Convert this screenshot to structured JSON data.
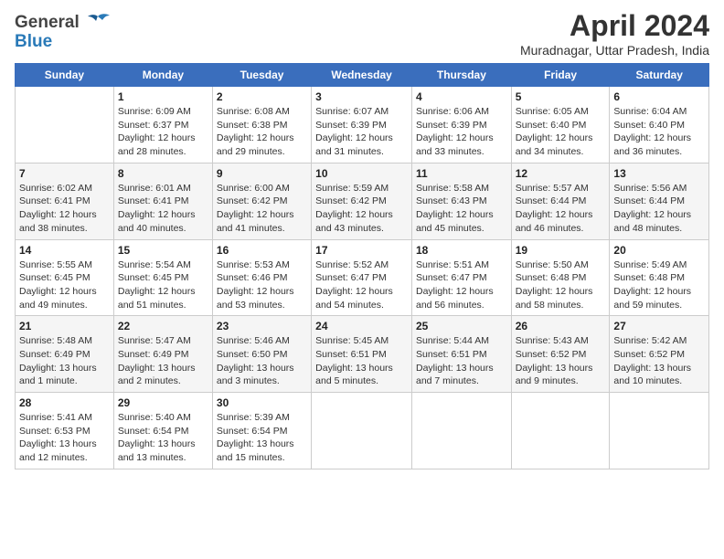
{
  "header": {
    "logo_line1": "General",
    "logo_line2": "Blue",
    "title": "April 2024",
    "subtitle": "Muradnagar, Uttar Pradesh, India"
  },
  "weekdays": [
    "Sunday",
    "Monday",
    "Tuesday",
    "Wednesday",
    "Thursday",
    "Friday",
    "Saturday"
  ],
  "weeks": [
    [
      {
        "day": "",
        "sunrise": "",
        "sunset": "",
        "daylight": ""
      },
      {
        "day": "1",
        "sunrise": "Sunrise: 6:09 AM",
        "sunset": "Sunset: 6:37 PM",
        "daylight": "Daylight: 12 hours and 28 minutes."
      },
      {
        "day": "2",
        "sunrise": "Sunrise: 6:08 AM",
        "sunset": "Sunset: 6:38 PM",
        "daylight": "Daylight: 12 hours and 29 minutes."
      },
      {
        "day": "3",
        "sunrise": "Sunrise: 6:07 AM",
        "sunset": "Sunset: 6:39 PM",
        "daylight": "Daylight: 12 hours and 31 minutes."
      },
      {
        "day": "4",
        "sunrise": "Sunrise: 6:06 AM",
        "sunset": "Sunset: 6:39 PM",
        "daylight": "Daylight: 12 hours and 33 minutes."
      },
      {
        "day": "5",
        "sunrise": "Sunrise: 6:05 AM",
        "sunset": "Sunset: 6:40 PM",
        "daylight": "Daylight: 12 hours and 34 minutes."
      },
      {
        "day": "6",
        "sunrise": "Sunrise: 6:04 AM",
        "sunset": "Sunset: 6:40 PM",
        "daylight": "Daylight: 12 hours and 36 minutes."
      }
    ],
    [
      {
        "day": "7",
        "sunrise": "Sunrise: 6:02 AM",
        "sunset": "Sunset: 6:41 PM",
        "daylight": "Daylight: 12 hours and 38 minutes."
      },
      {
        "day": "8",
        "sunrise": "Sunrise: 6:01 AM",
        "sunset": "Sunset: 6:41 PM",
        "daylight": "Daylight: 12 hours and 40 minutes."
      },
      {
        "day": "9",
        "sunrise": "Sunrise: 6:00 AM",
        "sunset": "Sunset: 6:42 PM",
        "daylight": "Daylight: 12 hours and 41 minutes."
      },
      {
        "day": "10",
        "sunrise": "Sunrise: 5:59 AM",
        "sunset": "Sunset: 6:42 PM",
        "daylight": "Daylight: 12 hours and 43 minutes."
      },
      {
        "day": "11",
        "sunrise": "Sunrise: 5:58 AM",
        "sunset": "Sunset: 6:43 PM",
        "daylight": "Daylight: 12 hours and 45 minutes."
      },
      {
        "day": "12",
        "sunrise": "Sunrise: 5:57 AM",
        "sunset": "Sunset: 6:44 PM",
        "daylight": "Daylight: 12 hours and 46 minutes."
      },
      {
        "day": "13",
        "sunrise": "Sunrise: 5:56 AM",
        "sunset": "Sunset: 6:44 PM",
        "daylight": "Daylight: 12 hours and 48 minutes."
      }
    ],
    [
      {
        "day": "14",
        "sunrise": "Sunrise: 5:55 AM",
        "sunset": "Sunset: 6:45 PM",
        "daylight": "Daylight: 12 hours and 49 minutes."
      },
      {
        "day": "15",
        "sunrise": "Sunrise: 5:54 AM",
        "sunset": "Sunset: 6:45 PM",
        "daylight": "Daylight: 12 hours and 51 minutes."
      },
      {
        "day": "16",
        "sunrise": "Sunrise: 5:53 AM",
        "sunset": "Sunset: 6:46 PM",
        "daylight": "Daylight: 12 hours and 53 minutes."
      },
      {
        "day": "17",
        "sunrise": "Sunrise: 5:52 AM",
        "sunset": "Sunset: 6:47 PM",
        "daylight": "Daylight: 12 hours and 54 minutes."
      },
      {
        "day": "18",
        "sunrise": "Sunrise: 5:51 AM",
        "sunset": "Sunset: 6:47 PM",
        "daylight": "Daylight: 12 hours and 56 minutes."
      },
      {
        "day": "19",
        "sunrise": "Sunrise: 5:50 AM",
        "sunset": "Sunset: 6:48 PM",
        "daylight": "Daylight: 12 hours and 58 minutes."
      },
      {
        "day": "20",
        "sunrise": "Sunrise: 5:49 AM",
        "sunset": "Sunset: 6:48 PM",
        "daylight": "Daylight: 12 hours and 59 minutes."
      }
    ],
    [
      {
        "day": "21",
        "sunrise": "Sunrise: 5:48 AM",
        "sunset": "Sunset: 6:49 PM",
        "daylight": "Daylight: 13 hours and 1 minute."
      },
      {
        "day": "22",
        "sunrise": "Sunrise: 5:47 AM",
        "sunset": "Sunset: 6:49 PM",
        "daylight": "Daylight: 13 hours and 2 minutes."
      },
      {
        "day": "23",
        "sunrise": "Sunrise: 5:46 AM",
        "sunset": "Sunset: 6:50 PM",
        "daylight": "Daylight: 13 hours and 3 minutes."
      },
      {
        "day": "24",
        "sunrise": "Sunrise: 5:45 AM",
        "sunset": "Sunset: 6:51 PM",
        "daylight": "Daylight: 13 hours and 5 minutes."
      },
      {
        "day": "25",
        "sunrise": "Sunrise: 5:44 AM",
        "sunset": "Sunset: 6:51 PM",
        "daylight": "Daylight: 13 hours and 7 minutes."
      },
      {
        "day": "26",
        "sunrise": "Sunrise: 5:43 AM",
        "sunset": "Sunset: 6:52 PM",
        "daylight": "Daylight: 13 hours and 9 minutes."
      },
      {
        "day": "27",
        "sunrise": "Sunrise: 5:42 AM",
        "sunset": "Sunset: 6:52 PM",
        "daylight": "Daylight: 13 hours and 10 minutes."
      }
    ],
    [
      {
        "day": "28",
        "sunrise": "Sunrise: 5:41 AM",
        "sunset": "Sunset: 6:53 PM",
        "daylight": "Daylight: 13 hours and 12 minutes."
      },
      {
        "day": "29",
        "sunrise": "Sunrise: 5:40 AM",
        "sunset": "Sunset: 6:54 PM",
        "daylight": "Daylight: 13 hours and 13 minutes."
      },
      {
        "day": "30",
        "sunrise": "Sunrise: 5:39 AM",
        "sunset": "Sunset: 6:54 PM",
        "daylight": "Daylight: 13 hours and 15 minutes."
      },
      {
        "day": "",
        "sunrise": "",
        "sunset": "",
        "daylight": ""
      },
      {
        "day": "",
        "sunrise": "",
        "sunset": "",
        "daylight": ""
      },
      {
        "day": "",
        "sunrise": "",
        "sunset": "",
        "daylight": ""
      },
      {
        "day": "",
        "sunrise": "",
        "sunset": "",
        "daylight": ""
      }
    ]
  ]
}
